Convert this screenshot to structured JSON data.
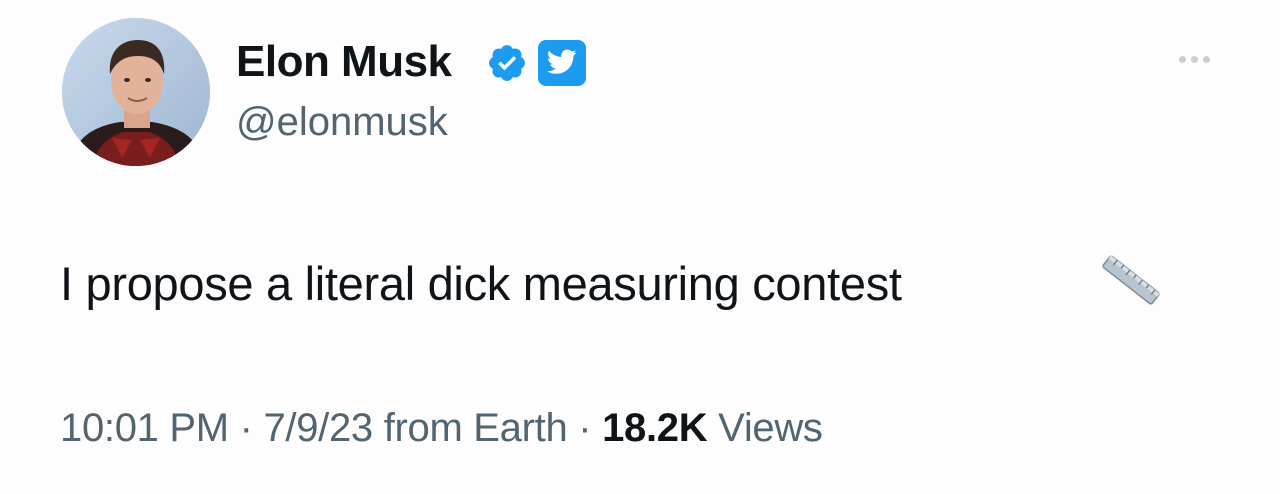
{
  "author": {
    "name": "Elon Musk",
    "handle": "@elonmusk"
  },
  "tweet": {
    "text": "I propose a literal dick measuring contest",
    "emoji_icon": "straight-ruler-icon"
  },
  "meta": {
    "time": "10:01 PM",
    "separator": " · ",
    "date_source": "7/9/23 from Earth",
    "views_count": "18.2K",
    "views_label": "Views"
  },
  "colors": {
    "verified_blue": "#1d9bf0",
    "secondary_text": "#536471",
    "primary_text": "#0f1419"
  }
}
